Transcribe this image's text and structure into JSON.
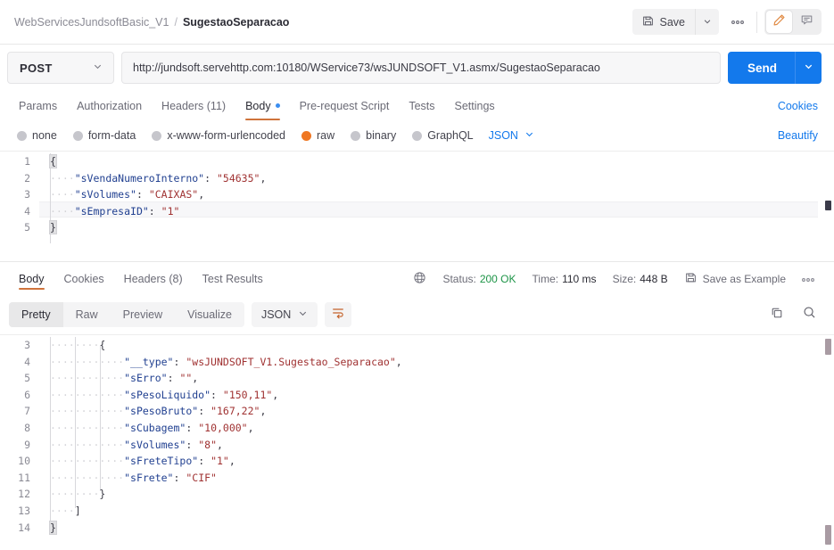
{
  "header": {
    "collection_name": "WebServicesJundsoftBasic_V1",
    "separator": "/",
    "request_name": "SugestaoSeparacao",
    "save_label": "Save",
    "ellipsis_label": "000"
  },
  "urlbar": {
    "method": "POST",
    "url": "http://jundsoft.servehttp.com:10180/WService73/wsJUNDSOFT_V1.asmx/SugestaoSeparacao",
    "send_label": "Send"
  },
  "request_tabs": {
    "items": [
      {
        "label": "Params",
        "active": false,
        "dot": false
      },
      {
        "label": "Authorization",
        "active": false,
        "dot": false
      },
      {
        "label": "Headers (11)",
        "active": false,
        "dot": false
      },
      {
        "label": "Body",
        "active": true,
        "dot": true
      },
      {
        "label": "Pre-request Script",
        "active": false,
        "dot": false
      },
      {
        "label": "Tests",
        "active": false,
        "dot": false
      },
      {
        "label": "Settings",
        "active": false,
        "dot": false
      }
    ],
    "cookies_link": "Cookies"
  },
  "body_types": {
    "options": [
      {
        "label": "none",
        "selected": false
      },
      {
        "label": "form-data",
        "selected": false
      },
      {
        "label": "x-www-form-urlencoded",
        "selected": false
      },
      {
        "label": "raw",
        "selected": true
      },
      {
        "label": "binary",
        "selected": false
      },
      {
        "label": "GraphQL",
        "selected": false
      }
    ],
    "format": "JSON",
    "beautify_link": "Beautify"
  },
  "request_body": {
    "lines": [
      {
        "num": "1",
        "indent": 0,
        "tokens": [
          {
            "t": "brace",
            "s": "{"
          }
        ]
      },
      {
        "num": "2",
        "indent": 1,
        "tokens": [
          {
            "t": "key",
            "s": "\"sVendaNumeroInterno\""
          },
          {
            "t": "punc",
            "s": ":"
          },
          {
            "t": "sp",
            "s": " "
          },
          {
            "t": "val",
            "s": "\"54635\""
          },
          {
            "t": "punc",
            "s": ","
          }
        ]
      },
      {
        "num": "3",
        "indent": 1,
        "tokens": [
          {
            "t": "key",
            "s": "\"sVolumes\""
          },
          {
            "t": "punc",
            "s": ":"
          },
          {
            "t": "sp",
            "s": " "
          },
          {
            "t": "val",
            "s": "\"CAIXAS\""
          },
          {
            "t": "punc",
            "s": ","
          }
        ]
      },
      {
        "num": "4",
        "indent": 1,
        "tokens": [
          {
            "t": "key",
            "s": "\"sEmpresaID\""
          },
          {
            "t": "punc",
            "s": ":"
          },
          {
            "t": "sp",
            "s": " "
          },
          {
            "t": "val",
            "s": "\"1\""
          }
        ]
      },
      {
        "num": "5",
        "indent": 0,
        "tokens": [
          {
            "t": "brace",
            "s": "}"
          }
        ]
      }
    ]
  },
  "response_tabs": {
    "items": [
      {
        "label": "Body",
        "active": true
      },
      {
        "label": "Cookies",
        "active": false
      },
      {
        "label": "Headers (8)",
        "active": false
      },
      {
        "label": "Test Results",
        "active": false
      }
    ]
  },
  "response_meta": {
    "status_label": "Status:",
    "status_value": "200 OK",
    "time_label": "Time:",
    "time_value": "110 ms",
    "size_label": "Size:",
    "size_value": "448 B",
    "save_as_example": "Save as Example",
    "ellipsis_label": "000"
  },
  "response_toolbar": {
    "views": [
      {
        "label": "Pretty",
        "active": true
      },
      {
        "label": "Raw",
        "active": false
      },
      {
        "label": "Preview",
        "active": false
      },
      {
        "label": "Visualize",
        "active": false
      }
    ],
    "format": "JSON"
  },
  "response_body": {
    "lines": [
      {
        "num": "3",
        "indent": 2,
        "tokens": [
          {
            "t": "punc",
            "s": "{"
          }
        ]
      },
      {
        "num": "4",
        "indent": 3,
        "tokens": [
          {
            "t": "key",
            "s": "\"__type\""
          },
          {
            "t": "punc",
            "s": ":"
          },
          {
            "t": "sp",
            "s": " "
          },
          {
            "t": "val",
            "s": "\"wsJUNDSOFT_V1.Sugestao_Separacao\""
          },
          {
            "t": "punc",
            "s": ","
          }
        ]
      },
      {
        "num": "5",
        "indent": 3,
        "tokens": [
          {
            "t": "key",
            "s": "\"sErro\""
          },
          {
            "t": "punc",
            "s": ":"
          },
          {
            "t": "sp",
            "s": " "
          },
          {
            "t": "val",
            "s": "\"\""
          },
          {
            "t": "punc",
            "s": ","
          }
        ]
      },
      {
        "num": "6",
        "indent": 3,
        "tokens": [
          {
            "t": "key",
            "s": "\"sPesoLiquido\""
          },
          {
            "t": "punc",
            "s": ":"
          },
          {
            "t": "sp",
            "s": " "
          },
          {
            "t": "val",
            "s": "\"150,11\""
          },
          {
            "t": "punc",
            "s": ","
          }
        ]
      },
      {
        "num": "7",
        "indent": 3,
        "tokens": [
          {
            "t": "key",
            "s": "\"sPesoBruto\""
          },
          {
            "t": "punc",
            "s": ":"
          },
          {
            "t": "sp",
            "s": " "
          },
          {
            "t": "val",
            "s": "\"167,22\""
          },
          {
            "t": "punc",
            "s": ","
          }
        ]
      },
      {
        "num": "8",
        "indent": 3,
        "tokens": [
          {
            "t": "key",
            "s": "\"sCubagem\""
          },
          {
            "t": "punc",
            "s": ":"
          },
          {
            "t": "sp",
            "s": " "
          },
          {
            "t": "val",
            "s": "\"10,000\""
          },
          {
            "t": "punc",
            "s": ","
          }
        ]
      },
      {
        "num": "9",
        "indent": 3,
        "tokens": [
          {
            "t": "key",
            "s": "\"sVolumes\""
          },
          {
            "t": "punc",
            "s": ":"
          },
          {
            "t": "sp",
            "s": " "
          },
          {
            "t": "val",
            "s": "\"8\""
          },
          {
            "t": "punc",
            "s": ","
          }
        ]
      },
      {
        "num": "10",
        "indent": 3,
        "tokens": [
          {
            "t": "key",
            "s": "\"sFreteTipo\""
          },
          {
            "t": "punc",
            "s": ":"
          },
          {
            "t": "sp",
            "s": " "
          },
          {
            "t": "val",
            "s": "\"1\""
          },
          {
            "t": "punc",
            "s": ","
          }
        ]
      },
      {
        "num": "11",
        "indent": 3,
        "tokens": [
          {
            "t": "key",
            "s": "\"sFrete\""
          },
          {
            "t": "punc",
            "s": ":"
          },
          {
            "t": "sp",
            "s": " "
          },
          {
            "t": "val",
            "s": "\"CIF\""
          }
        ]
      },
      {
        "num": "12",
        "indent": 2,
        "tokens": [
          {
            "t": "punc",
            "s": "}"
          }
        ]
      },
      {
        "num": "13",
        "indent": 1,
        "tokens": [
          {
            "t": "punc",
            "s": "]"
          }
        ]
      },
      {
        "num": "14",
        "indent": 0,
        "tokens": [
          {
            "t": "brace",
            "s": "}"
          }
        ]
      }
    ]
  },
  "colors": {
    "accent_orange": "#cf733b",
    "send_blue": "#1379ec",
    "link_blue": "#1379ec",
    "status_green": "#1d9447",
    "radio_selected": "#ef7723",
    "json_key": "#224191",
    "json_value": "#a03232"
  }
}
